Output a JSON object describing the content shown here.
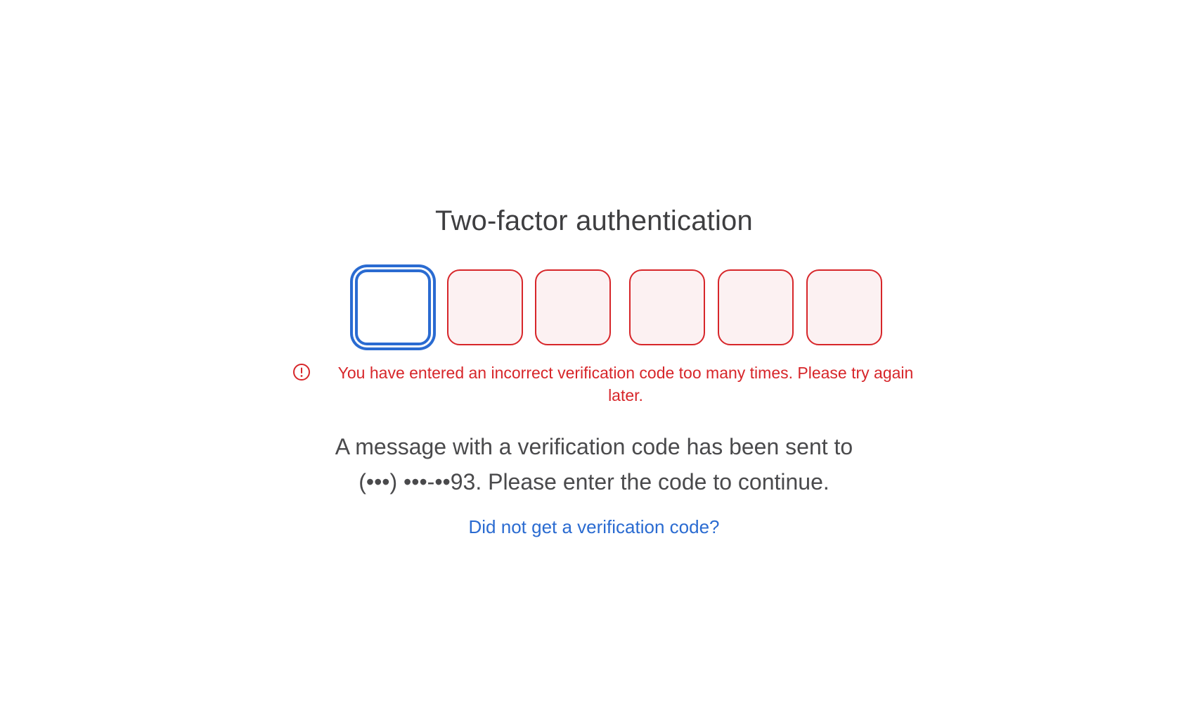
{
  "title": "Two-factor authentication",
  "code_inputs": [
    {
      "value": "",
      "state": "focused"
    },
    {
      "value": "",
      "state": "error"
    },
    {
      "value": "",
      "state": "error"
    },
    {
      "value": "",
      "state": "error"
    },
    {
      "value": "",
      "state": "error"
    },
    {
      "value": "",
      "state": "error"
    }
  ],
  "error": {
    "icon": "exclamation-circle-icon",
    "text": "You have entered an incorrect verification code too many times. Please try again later."
  },
  "message": "A message with a verification code has been sent to (•••) •••-••93. Please enter the code to continue.",
  "resend_link": "Did not get a verification code?",
  "colors": {
    "error": "#d7262a",
    "error_bg": "#fcf1f2",
    "focus": "#2a6bd1",
    "link": "#2a6bd1",
    "text": "#3e3e40"
  }
}
